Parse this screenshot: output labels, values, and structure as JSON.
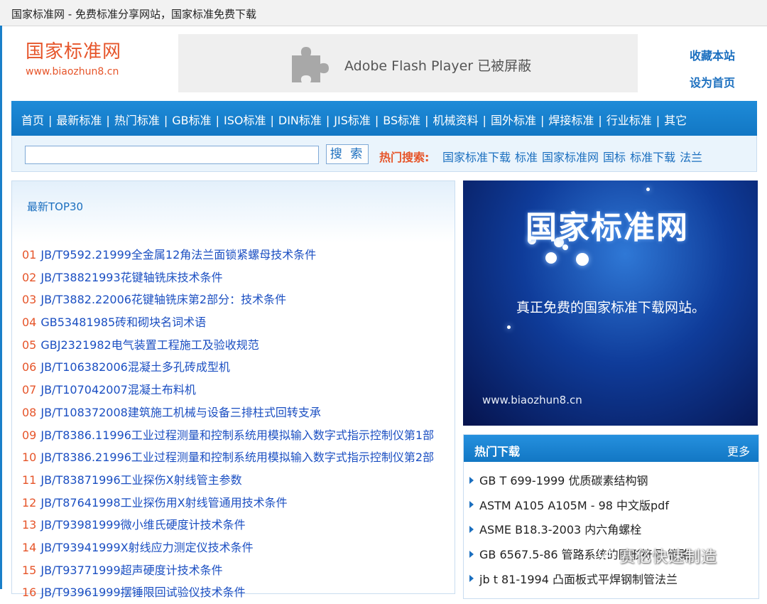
{
  "window": {
    "title": "国家标准网 - 免费标准分享网站，国家标准免费下载"
  },
  "header": {
    "logo_title": "国家标准网",
    "logo_url": "www.biaozhun8.cn",
    "flash_text": "Adobe Flash Player 已被屏蔽",
    "bookmark_link": "收藏本站",
    "homepage_link": "设为首页"
  },
  "nav": {
    "items": [
      "首页",
      "最新标准",
      "热门标准",
      "GB标准",
      "ISO标准",
      "DIN标准",
      "JIS标准",
      "BS标准",
      "机械资料",
      "国外标准",
      "焊接标准",
      "行业标准",
      "其它"
    ],
    "separator": "|"
  },
  "search": {
    "input_value": "",
    "button_label": "搜 索",
    "hot_label": "热门搜索:",
    "hot_words": [
      "国家标准下载",
      "标准",
      "国家标准网",
      "国标",
      "标准下载",
      "法兰"
    ]
  },
  "top30": {
    "heading": "最新TOP30",
    "items": [
      {
        "num": "01",
        "title": "JB/T9592.21999全金属12角法兰面锁紧螺母技术条件"
      },
      {
        "num": "02",
        "title": "JB/T38821993花键轴铣床技术条件"
      },
      {
        "num": "03",
        "title": "JB/T3882.22006花键轴铣床第2部分：技术条件"
      },
      {
        "num": "04",
        "title": "GB53481985砖和砌块名词术语"
      },
      {
        "num": "05",
        "title": "GBJ2321982电气装置工程施工及验收规范"
      },
      {
        "num": "06",
        "title": "JB/T106382006混凝土多孔砖成型机"
      },
      {
        "num": "07",
        "title": "JB/T107042007混凝土布料机"
      },
      {
        "num": "08",
        "title": "JB/T108372008建筑施工机械与设备三排柱式回转支承"
      },
      {
        "num": "09",
        "title": "JB/T8386.11996工业过程测量和控制系统用模拟输入数字式指示控制仪第1部"
      },
      {
        "num": "10",
        "title": "JB/T8386.21996工业过程测量和控制系统用模拟输入数字式指示控制仪第2部"
      },
      {
        "num": "11",
        "title": "JB/T83871996工业探伤X射线管主参数"
      },
      {
        "num": "12",
        "title": "JB/T87641998工业探伤用X射线管通用技术条件"
      },
      {
        "num": "13",
        "title": "JB/T93981999微小维氏硬度计技术条件"
      },
      {
        "num": "14",
        "title": "JB/T93941999X射线应力测定仪技术条件"
      },
      {
        "num": "15",
        "title": "JB/T93771999超声硬度计技术条件"
      },
      {
        "num": "16",
        "title": "JB/T93961999摆锤限回试验仪技术条件"
      }
    ]
  },
  "banner": {
    "title": "国家标准网",
    "subtitle": "真正免费的国家标准下载网站。",
    "url": "www.biaozhun8.cn"
  },
  "hot_downloads": {
    "heading": "热门下载",
    "more": "更多",
    "items": [
      "GB T 699-1999 优质碳素结构钢",
      "ASTM A105 A105M - 98 中文版pdf",
      "ASME B18.3-2003 内六角螺栓",
      "GB 6567.5-86 管路系统的图形符号 管路",
      "jb t 81-1994 凸面板式平焊钢制管法兰"
    ]
  },
  "watermark": {
    "text": "赛亿快速制造",
    "icon": "wechat-icon"
  }
}
